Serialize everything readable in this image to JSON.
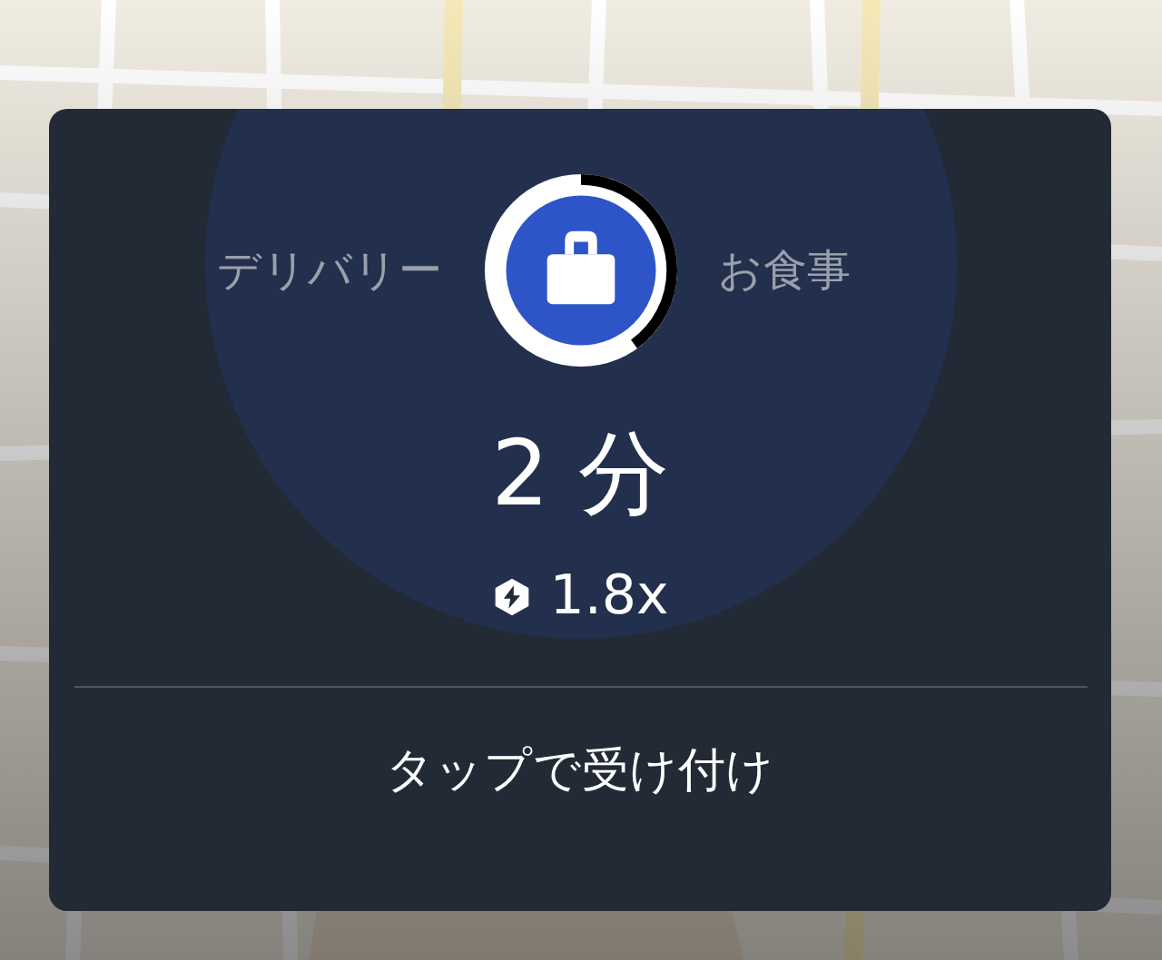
{
  "offer": {
    "left_label": "デリバリー",
    "right_label": "お食事",
    "eta": "2 分",
    "surge": "1.8x",
    "action": "タップで受け付け"
  }
}
